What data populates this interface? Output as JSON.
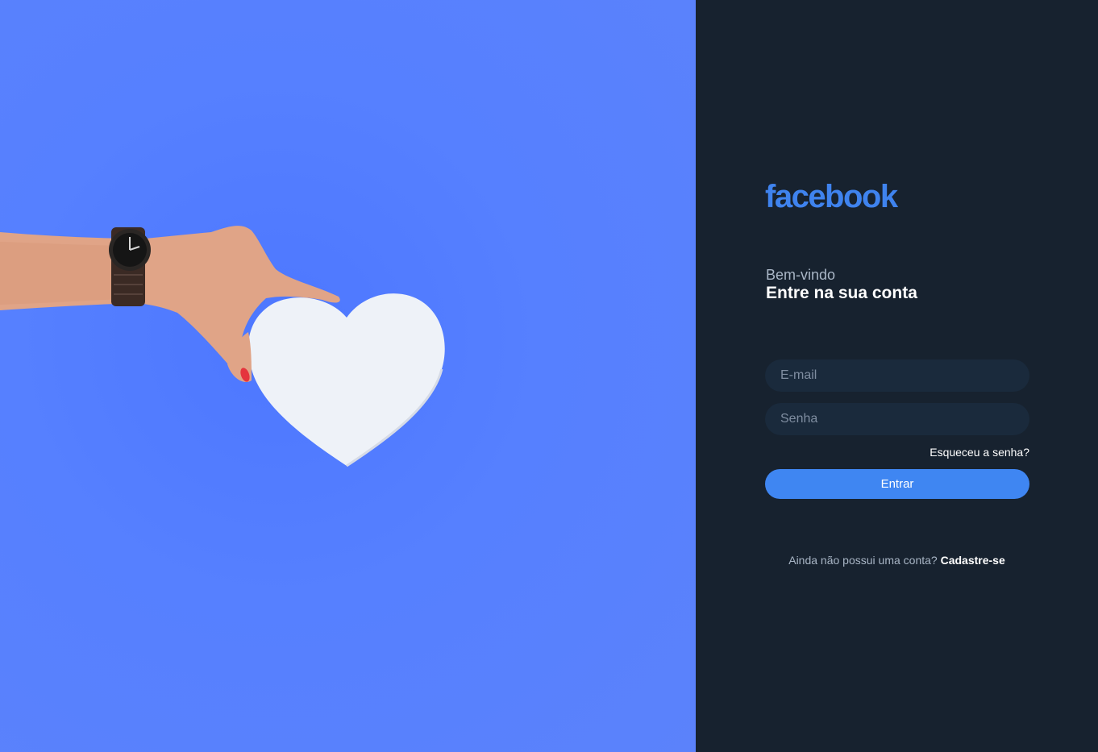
{
  "hero": {
    "image": "hand-holding-white-heart-photo"
  },
  "login": {
    "logo_text": "facebook",
    "welcome": "Bem-vindo",
    "title": "Entre na sua conta",
    "email_placeholder": "E-mail",
    "password_placeholder": "Senha",
    "forgot_link": "Esqueceu a senha?",
    "submit_label": "Entrar",
    "signup_prompt": "Ainda não possui uma conta?",
    "signup_link": "Cadastre-se"
  },
  "colors": {
    "panel_bg": "#17222f",
    "hero_bg": "#5680ff",
    "brand_blue": "#3f83ee",
    "button_blue": "#3f86f2",
    "field_bg": "#1a2a3c"
  }
}
